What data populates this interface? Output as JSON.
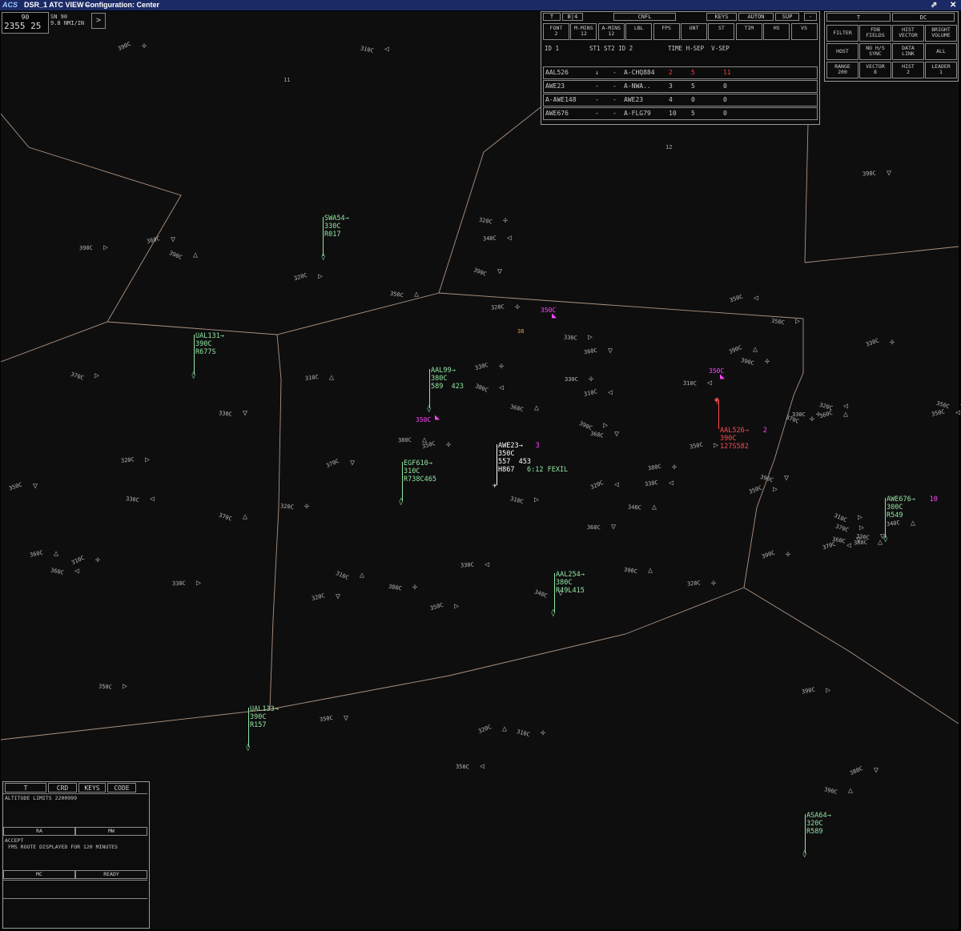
{
  "window": {
    "logo": "ACS",
    "title": "DSR_1 ATC VIEW –",
    "config": "Configuration: Center",
    "restore": "⇗",
    "close": "✕"
  },
  "clock": {
    "level": "90",
    "time": "2355 25",
    "sn": "SN 90",
    "scale": "9.8 NMI/IN",
    "expand": ">"
  },
  "conflict_panel": {
    "tabs": [
      "T",
      "B|4",
      "CNFL",
      "KEYS",
      "AUTON",
      "SUP",
      "-"
    ],
    "buttons": [
      {
        "top": "FONT",
        "bot": "2"
      },
      {
        "top": "M-MINS",
        "bot": "12"
      },
      {
        "top": "A-MINS",
        "bot": "12"
      },
      {
        "top": "LBL",
        "bot": ""
      },
      {
        "top": "FPS",
        "bot": ""
      },
      {
        "top": "UNT",
        "bot": ""
      },
      {
        "top": "ST",
        "bot": ""
      },
      {
        "top": "TIM",
        "bot": ""
      },
      {
        "top": "HS",
        "bot": ""
      },
      {
        "top": "VS",
        "bot": ""
      }
    ],
    "header": {
      "id1": "ID 1",
      "st": "ST1 ST2 ID 2",
      "time": "TIME H-SEP  V-SEP"
    },
    "rows": [
      {
        "id1": "AAL526",
        "st1": "↓",
        "st2": "-",
        "id2": "A-CHQ884",
        "time": "2",
        "hsep": "5",
        "vsep": "11",
        "alert": true
      },
      {
        "id1": "AWE23",
        "st1": "-",
        "st2": "-",
        "id2": "A-NWA..",
        "time": "3",
        "hsep": "5",
        "vsep": "0",
        "alert": false
      },
      {
        "id1": "A-AWE148",
        "st1": "-",
        "st2": "-",
        "id2": "AWE23",
        "time": "4",
        "hsep": "0",
        "vsep": "0",
        "alert": false
      },
      {
        "id1": "AWE676",
        "st1": "-",
        "st2": "-",
        "id2": "A-FLG79",
        "time": "10",
        "hsep": "5",
        "vsep": "0",
        "alert": false
      }
    ]
  },
  "dc_panel": {
    "tabs": [
      "T",
      "DC"
    ],
    "buttons": [
      {
        "top": "FILTER",
        "bot": ""
      },
      {
        "top": "FDB",
        "bot": "FIELDS"
      },
      {
        "top": "HIST",
        "bot": "VECTOR"
      },
      {
        "top": "BRIGHT",
        "bot": "VOLUME"
      },
      {
        "top": "HOST",
        "bot": ""
      },
      {
        "top": "NO H/S",
        "bot": "SYNC"
      },
      {
        "top": "DATA",
        "bot": "LINK"
      },
      {
        "top": "ALL",
        "bot": ""
      },
      {
        "top": "RANGE",
        "bot": "200"
      },
      {
        "top": "VECTOR",
        "bot": "8"
      },
      {
        "top": "HIST",
        "bot": "2"
      },
      {
        "top": "LEADER",
        "bot": "1"
      }
    ]
  },
  "mca": {
    "tabs": [
      "T",
      "CRD",
      "KEYS",
      "CODE"
    ],
    "altitude": "ALTITUDE LIMITS 2200999",
    "ra": "RA",
    "mw": "MW",
    "accept": "ACCEPT",
    "message": "FMS ROUTE DISPLAYED FOR 120 MINUTES",
    "mc": "MC",
    "ready": "READY"
  },
  "datablocks": [
    {
      "lines": [
        "SWA54→",
        "330C",
        "R017"
      ],
      "color": "#8fe6a0"
    },
    {
      "lines": [
        "UAL131→",
        "390C",
        "R677S"
      ],
      "color": "#8fe6a0"
    },
    {
      "lines": [
        "AAL99→",
        "380C",
        "589  423"
      ],
      "color": "#8fe6a0"
    },
    {
      "lines": [
        "EGF610→",
        "310C",
        "R738C465"
      ],
      "color": "#8fe6a0"
    },
    {
      "lines": [
        "AWE23→",
        "350C",
        "557  453",
        "H867"
      ],
      "color": "#ffffff",
      "extra": "3",
      "route": "6:12 FEXIL"
    },
    {
      "lines": [
        "AAL526→",
        "390C",
        "127S582"
      ],
      "color": "#ff4b4b",
      "extra": "2"
    },
    {
      "lines": [
        "AWE676→",
        "300C",
        "R549"
      ],
      "color": "#8fe6a0",
      "extra": "10"
    },
    {
      "lines": [
        "AAL254→",
        "380C",
        "R49L415"
      ],
      "color": "#8fe6a0"
    },
    {
      "lines": [
        "UAL133→",
        "390C",
        "R157"
      ],
      "color": "#8fe6a0"
    },
    {
      "lines": [
        "ASA64→",
        "320C",
        "R589"
      ],
      "color": "#8fe6a0"
    }
  ],
  "limited_blocks": [
    "350C",
    "350C",
    "350C",
    "350C"
  ],
  "sector_labels": [
    "11",
    "12",
    "38"
  ],
  "alt_tags": [
    "390C",
    "310C",
    "390C",
    "360C",
    "390C",
    "320C",
    "340C",
    "320C",
    "390C",
    "350C",
    "320C",
    "350C",
    "370C",
    "330C",
    "310C",
    "330C",
    "350C",
    "330C",
    "360C",
    "390C",
    "390C",
    "310C",
    "350C",
    "370C",
    "360C",
    "330C",
    "310C",
    "390C",
    "360C",
    "380C",
    "350C",
    "380C",
    "350C",
    "390C",
    "360C",
    "370C",
    "330C",
    "320C",
    "350C",
    "370C",
    "320C",
    "330C",
    "350C",
    "390C",
    "340C",
    "380C",
    "320C",
    "310C",
    "360C",
    "360C",
    "310C",
    "360C",
    "330C",
    "320C",
    "310C",
    "380C",
    "330C",
    "350C",
    "340C",
    "390C",
    "320C",
    "370C",
    "370C",
    "330C",
    "340C",
    "390C",
    "320C",
    "350C",
    "350C",
    "320C",
    "310C",
    "350C",
    "390C",
    "380C",
    "390C",
    "330C",
    "350C",
    "310C",
    "360C",
    "380C",
    "330C"
  ],
  "colors": {
    "background": "#0f0e0f",
    "sector_line": "#c8ac94",
    "accent": "#1b2a64",
    "alert": "#ff4b4b",
    "pointout": "#ff46ff",
    "datablock": "#8fe6a0"
  }
}
